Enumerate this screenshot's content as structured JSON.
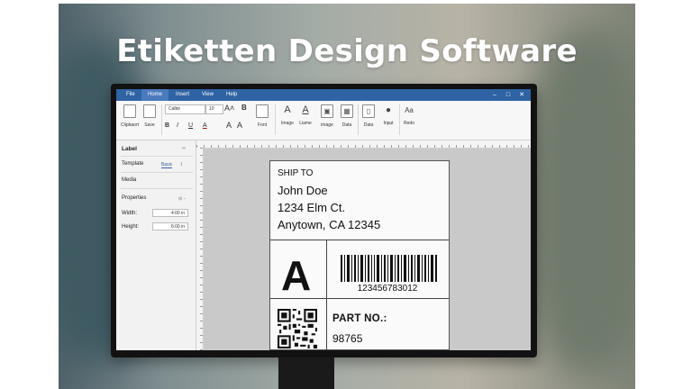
{
  "headline": "Etiketten Design Software",
  "app": {
    "menu": [
      "File",
      "Home",
      "Insert",
      "View",
      "Help"
    ],
    "active_menu": "Home",
    "window_controls": [
      "–",
      "□",
      "✕"
    ]
  },
  "ribbon": {
    "clipboard_label": "Clipbaort",
    "save_label": "Save",
    "font_name": "Calbé",
    "font_size": "10",
    "grow_glyph": "A˄",
    "bold": "B",
    "italic": "I",
    "underline": "U",
    "font_color": "A",
    "font_label": "Font",
    "tools": [
      {
        "label": "Image",
        "glyph": "A"
      },
      {
        "label": "Liame",
        "glyph": "A"
      },
      {
        "label": "image",
        "glyph": "▣"
      },
      {
        "label": "Data",
        "glyph": "▦"
      },
      {
        "label": "Data",
        "glyph": "▯"
      },
      {
        "label": "Input",
        "glyph": "●"
      },
      {
        "label": "Redo",
        "glyph": "Aa"
      }
    ]
  },
  "panel": {
    "title": "Label",
    "title_icon": "‹›",
    "template_label": "Template",
    "tab_basic": "Basic",
    "tab_next": "I",
    "media_label": "Media",
    "properties_label": "Properties",
    "properties_icon": "⊞ −",
    "width_label": "Width:",
    "width_value": "4:00 in",
    "height_label": "Height:",
    "height_value": "6:00 in"
  },
  "label": {
    "ship_to": "SHIP TO",
    "name": "John Doe",
    "street": "1234 Elm Ct.",
    "city": "Anytown, CA 12345",
    "zone": "A",
    "barcode_number": "123456783012",
    "part_label": "PART NO.:",
    "part_number": "98765"
  },
  "colors": {
    "titlebar": "#2f63a3",
    "accent_tab": "#2f63a3"
  },
  "icons": {
    "clipboard": "clipboard-icon",
    "save": "save-icon",
    "barcode": "barcode-icon",
    "qr": "qr-code-icon"
  }
}
